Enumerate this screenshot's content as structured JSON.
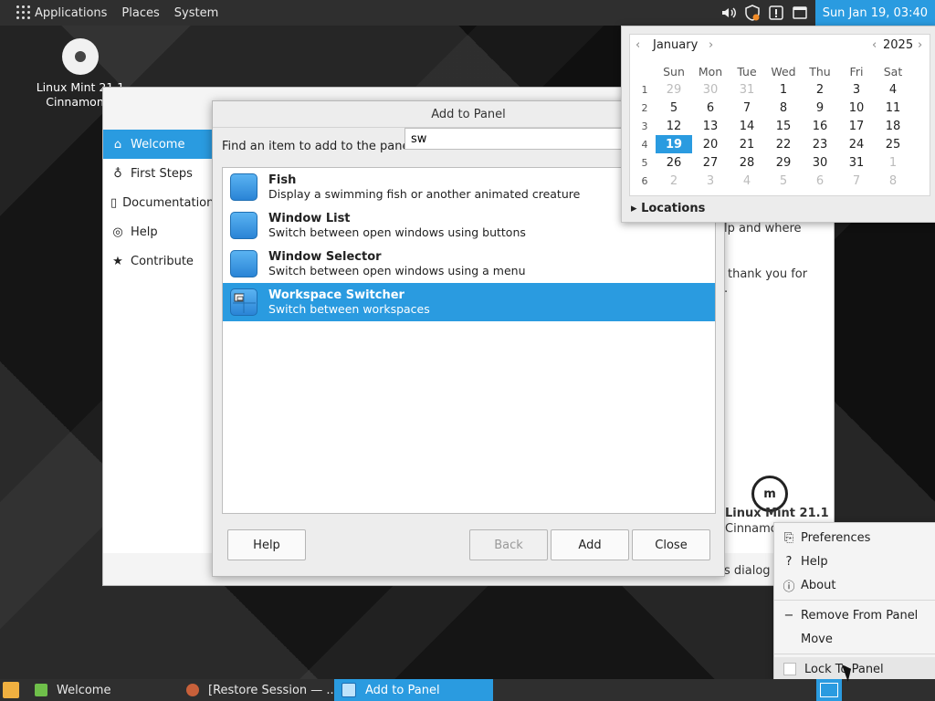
{
  "top_panel": {
    "menus": [
      "Applications",
      "Places",
      "System"
    ],
    "clock": "Sun Jan 19, 03:40"
  },
  "desktop_icon": {
    "line1": "Linux Mint 21.1",
    "line2": "Cinnamon 6"
  },
  "welcome": {
    "sidebar": [
      {
        "label": "Welcome",
        "icon": "home-icon",
        "active": true
      },
      {
        "label": "First Steps",
        "icon": "bulb-icon"
      },
      {
        "label": "Documentation",
        "icon": "book-icon"
      },
      {
        "label": "Help",
        "icon": "lifebuoy-icon"
      },
      {
        "label": "Contribute",
        "icon": "star-icon"
      }
    ],
    "text_fragment_1": "lp and where",
    "text_fragment_2": "thank you for",
    "text_fragment_3": ".",
    "brand_line1": "Linux Mint 21.1",
    "brand_line2": "Cinnamon",
    "footer_fragment": "s dialog a"
  },
  "dialog": {
    "title": "Add to Panel",
    "find_label": "Find an item to add to the panel:",
    "search_value": "sw",
    "items": [
      {
        "name": "Fish",
        "description": "Display a swimming fish or another animated creature",
        "selected": false
      },
      {
        "name": "Window List",
        "description": "Switch between open windows using buttons",
        "selected": false
      },
      {
        "name": "Window Selector",
        "description": "Switch between open windows using a menu",
        "selected": false
      },
      {
        "name": "Workspace Switcher",
        "description": "Switch between workspaces",
        "selected": true
      }
    ],
    "buttons": {
      "help": "Help",
      "back": "Back",
      "add": "Add",
      "close": "Close"
    }
  },
  "calendar": {
    "month": "January",
    "year": "2025",
    "weekdays": [
      "Sun",
      "Mon",
      "Tue",
      "Wed",
      "Thu",
      "Fri",
      "Sat"
    ],
    "weeks": [
      {
        "wk": "1",
        "days": [
          "29",
          "30",
          "31",
          "1",
          "2",
          "3",
          "4"
        ],
        "dim": [
          0,
          1,
          2
        ]
      },
      {
        "wk": "2",
        "days": [
          "5",
          "6",
          "7",
          "8",
          "9",
          "10",
          "11"
        ],
        "dim": []
      },
      {
        "wk": "3",
        "days": [
          "12",
          "13",
          "14",
          "15",
          "16",
          "17",
          "18"
        ],
        "dim": []
      },
      {
        "wk": "4",
        "days": [
          "19",
          "20",
          "21",
          "22",
          "23",
          "24",
          "25"
        ],
        "dim": [],
        "today": 0
      },
      {
        "wk": "5",
        "days": [
          "26",
          "27",
          "28",
          "29",
          "30",
          "31",
          "1"
        ],
        "dim": [
          6
        ]
      },
      {
        "wk": "6",
        "days": [
          "2",
          "3",
          "4",
          "5",
          "6",
          "7",
          "8"
        ],
        "dim": [
          0,
          1,
          2,
          3,
          4,
          5,
          6
        ]
      }
    ],
    "locations_label": "Locations"
  },
  "context_menu": {
    "items": [
      "Preferences",
      "Help",
      "About"
    ],
    "items2": [
      "Remove From Panel",
      "Move"
    ],
    "lock_label": "Lock To Panel"
  },
  "taskbar": {
    "tasks": [
      "Welcome",
      "[Restore Session — ...",
      "Add to Panel"
    ]
  },
  "colors": {
    "accent": "#2a9be0"
  }
}
